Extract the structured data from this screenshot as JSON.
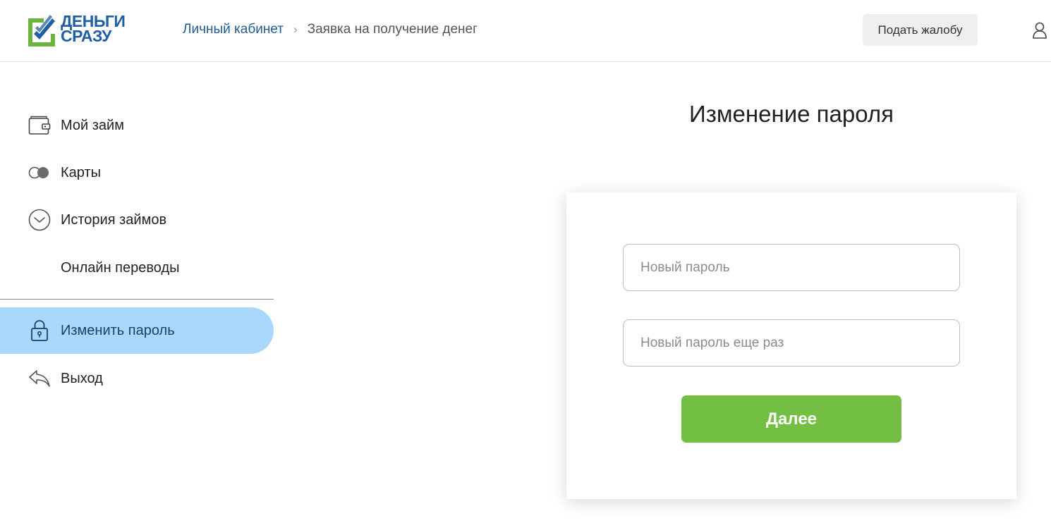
{
  "header": {
    "logo": {
      "line1": "ДЕНЬГИ",
      "line2": "СРАЗУ"
    },
    "breadcrumb": {
      "home": "Личный кабинет",
      "separator": "›",
      "current": "Заявка на получение денег"
    },
    "complaint_button": "Подать жалобу",
    "user_icon": "user-icon"
  },
  "sidebar": {
    "items": [
      {
        "label": "Мой займ",
        "icon": "wallet-icon",
        "active": false
      },
      {
        "label": "Карты",
        "icon": "cards-icon",
        "active": false
      },
      {
        "label": "История займов",
        "icon": "clock-icon",
        "active": false
      },
      {
        "label": "Онлайн переводы",
        "icon": "",
        "active": false
      },
      {
        "label": "Изменить пароль",
        "icon": "lock-icon",
        "active": true
      },
      {
        "label": "Выход",
        "icon": "logout-arrow-icon",
        "active": false
      }
    ]
  },
  "main": {
    "title": "Изменение пароля",
    "form": {
      "new_password_placeholder": "Новый пароль",
      "repeat_password_placeholder": "Новый пароль еще раз",
      "submit_label": "Далее"
    }
  },
  "colors": {
    "brand_blue": "#1f5fa6",
    "brand_green": "#72bf44",
    "active_item_bg": "#a9d8fc",
    "link": "#1f5b94"
  }
}
